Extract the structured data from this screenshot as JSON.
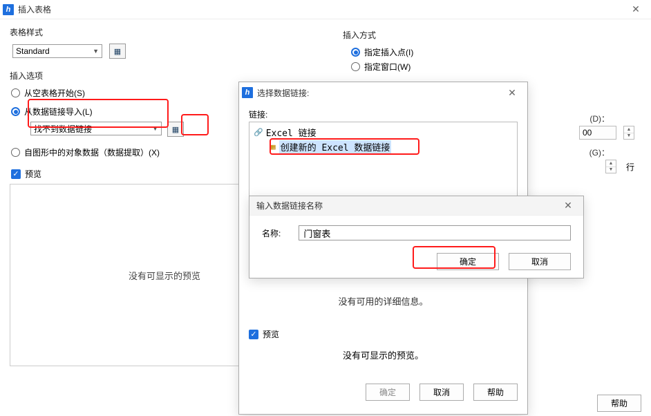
{
  "dialog1": {
    "title": "插入表格",
    "left": {
      "table_style_heading": "表格样式",
      "table_style_value": "Standard",
      "insert_options_heading": "插入选项",
      "opt_empty": "从空表格开始(S)",
      "opt_link": "从数据链接导入(L)",
      "datalink_value": "找不到数据链接",
      "opt_extract": "自图形中的对象数据（数据提取）(X)",
      "preview_label": "预览",
      "preview_empty": "没有可显示的预览"
    },
    "right": {
      "insert_method_heading": "插入方式",
      "opt_point": "指定插入点(I)",
      "opt_window": "指定窗口(W)",
      "param_d_tail": "(D)：",
      "param_d_val": "00",
      "param_g_tail": "(G)：",
      "unit_row": "行"
    },
    "footer": {
      "help": "帮助"
    }
  },
  "dialog2": {
    "title": "选择数据链接:",
    "link_label": "链接:",
    "tree_root": "Excel 链接",
    "tree_item": "创建新的 Excel 数据链接",
    "no_details": "没有可用的详细信息。",
    "preview_label": "预览",
    "preview_empty": "没有可显示的预览。",
    "ok": "确定",
    "cancel": "取消",
    "help": "帮助"
  },
  "dialog3": {
    "title": "输入数据链接名称",
    "name_label": "名称:",
    "name_value": "门窗表",
    "ok": "确定",
    "cancel": "取消"
  }
}
